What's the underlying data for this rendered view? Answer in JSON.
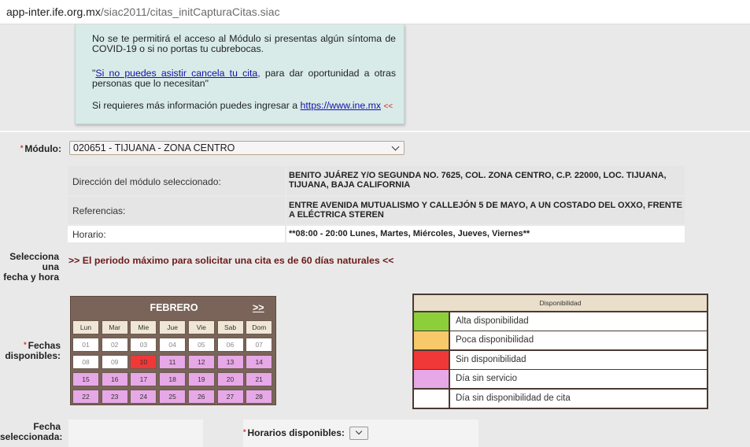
{
  "browser": {
    "url_host": "app-inter.ife.org.mx",
    "url_path": "/siac2011/citas_initCapturaCitas.siac"
  },
  "notice": {
    "para1": "No se te permitirá el acceso al Módulo si presentas algún síntoma de COVID-19 o si no portas tu cubrebocas.",
    "para2_link": "Si no puedes asistir cancela tu cita",
    "para2_open_quote": "\"",
    "para2_rest": ", para dar oportunidad a otras personas que lo necesitan\"",
    "para3_prefix": "Si requieres más información puedes ingresar a ",
    "para3_link": "https://www.ine.mx",
    "para3_suffix": "<<"
  },
  "form": {
    "required_mark": "*",
    "modulo_label": "Módulo:",
    "modulo_value": "020651 - TIJUANA - ZONA CENTRO",
    "direccion_label": "Dirección del módulo seleccionado:",
    "direccion_value": "BENITO JUÁREZ Y/O SEGUNDA NO. 7625, COL. ZONA CENTRO, C.P. 22000, LOC. TIJUANA, TIJUANA, BAJA CALIFORNIA",
    "referencias_label": "Referencias:",
    "referencias_value": "ENTRE AVENIDA MUTUALISMO Y CALLEJÓN 5 DE MAYO, A UN COSTADO DEL OXXO, FRENTE A ELÉCTRICA STEREN",
    "horario_label": "Horario:",
    "horario_value": "**08:00 - 20:00 Lunes, Martes, Miércoles, Jueves, Viernes**",
    "selecciona_label_1": "Selecciona",
    "selecciona_label_2": "una",
    "selecciona_label_3": "fecha y hora",
    "periodo_text": ">> El periodo máximo para solicitar una cita es de 60 días naturales <<",
    "fechas_label_1": "Fechas",
    "fechas_label_2": "disponibles:",
    "fecha_sel_label_1": "Fecha",
    "fecha_sel_label_2": "seleccionada:",
    "horarios_label": "Horarios disponibles:"
  },
  "calendar": {
    "month": "FEBRERO",
    "next_label": ">>",
    "weekdays": [
      "Lun",
      "Mar",
      "Mie",
      "Jue",
      "Vie",
      "Sab",
      "Dom"
    ],
    "weeks": [
      [
        {
          "d": "01",
          "s": "past"
        },
        {
          "d": "02",
          "s": "past"
        },
        {
          "d": "03",
          "s": "past"
        },
        {
          "d": "04",
          "s": "past"
        },
        {
          "d": "05",
          "s": "past"
        },
        {
          "d": "06",
          "s": "past"
        },
        {
          "d": "07",
          "s": "past"
        }
      ],
      [
        {
          "d": "08",
          "s": "past"
        },
        {
          "d": "09",
          "s": "past"
        },
        {
          "d": "10",
          "s": "sin"
        },
        {
          "d": "11",
          "s": "nosrv"
        },
        {
          "d": "12",
          "s": "nosrv"
        },
        {
          "d": "13",
          "s": "nosrv"
        },
        {
          "d": "14",
          "s": "nosrv"
        }
      ],
      [
        {
          "d": "15",
          "s": "nosrv"
        },
        {
          "d": "16",
          "s": "nosrv"
        },
        {
          "d": "17",
          "s": "nosrv"
        },
        {
          "d": "18",
          "s": "nosrv"
        },
        {
          "d": "19",
          "s": "nosrv"
        },
        {
          "d": "20",
          "s": "nosrv"
        },
        {
          "d": "21",
          "s": "nosrv"
        }
      ],
      [
        {
          "d": "22",
          "s": "nosrv"
        },
        {
          "d": "23",
          "s": "nosrv"
        },
        {
          "d": "24",
          "s": "nosrv"
        },
        {
          "d": "25",
          "s": "nosrv"
        },
        {
          "d": "26",
          "s": "nosrv"
        },
        {
          "d": "27",
          "s": "nosrv"
        },
        {
          "d": "28",
          "s": "nosrv"
        }
      ]
    ]
  },
  "legend": {
    "title": "Disponibilidad",
    "items": [
      {
        "label": "Alta disponibilidad",
        "color": "#8ccf3a"
      },
      {
        "label": "Poca disponibilidad",
        "color": "#f7c96a"
      },
      {
        "label": "Sin disponibilidad",
        "color": "#f03838"
      },
      {
        "label": "Día sin servicio",
        "color": "#e6a8e6"
      },
      {
        "label": "Día sin disponibilidad de cita",
        "color": "#ffffff"
      }
    ]
  }
}
